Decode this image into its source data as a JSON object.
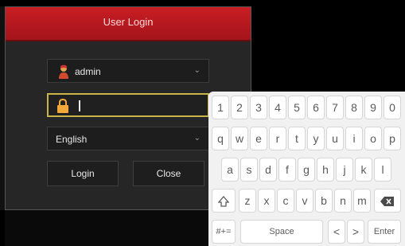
{
  "login": {
    "title": "User Login",
    "username": "admin",
    "language": "English",
    "login_label": "Login",
    "close_label": "Close"
  },
  "keyboard": {
    "rows": [
      [
        "1",
        "2",
        "3",
        "4",
        "5",
        "6",
        "7",
        "8",
        "9",
        "0"
      ],
      [
        "q",
        "w",
        "e",
        "r",
        "t",
        "y",
        "u",
        "i",
        "o",
        "p"
      ],
      [
        "a",
        "s",
        "d",
        "f",
        "g",
        "h",
        "j",
        "k",
        "l"
      ],
      [
        "z",
        "x",
        "c",
        "v",
        "b",
        "n",
        "m"
      ]
    ],
    "symbols_label": "#+=",
    "space_label": "Space",
    "left_label": "<",
    "right_label": ">",
    "enter_label": "Enter"
  },
  "colors": {
    "header_red": "#c81e24",
    "focus_border": "#c9b449",
    "window_bg": "#262626",
    "keyboard_bg": "#f1f1f1"
  },
  "icons": [
    "user-avatar-icon",
    "lock-icon",
    "chevron-down-icon",
    "shift-icon",
    "backspace-icon"
  ]
}
